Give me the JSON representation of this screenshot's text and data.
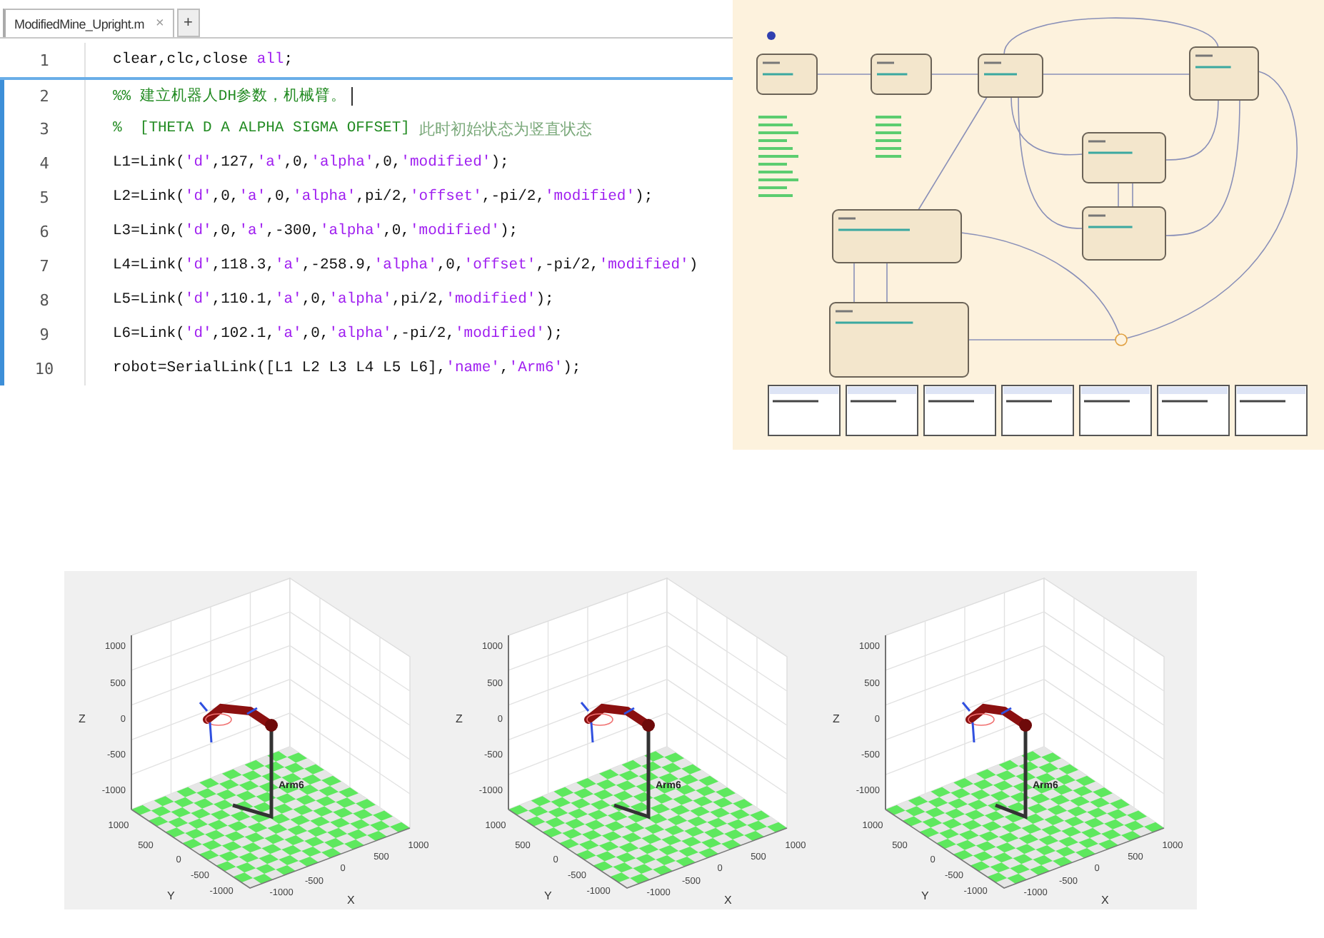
{
  "editor": {
    "tab": {
      "label": "ModifiedMine_Upright.m",
      "close": "×",
      "selected": true
    },
    "new_tab": "+",
    "lines": [
      {
        "number": "1",
        "in_section": false,
        "tokens": [
          {
            "kind": "code",
            "text": "clear,clc,close "
          },
          {
            "kind": "keyword",
            "text": "all"
          },
          {
            "kind": "code",
            "text": ";"
          }
        ]
      },
      {
        "number": "2",
        "in_section": true,
        "cursor": true,
        "tokens": [
          {
            "kind": "comment",
            "text": "%% 建立机器人DH参数，机械臂。"
          }
        ]
      },
      {
        "number": "3",
        "in_section": true,
        "tokens": [
          {
            "kind": "comment",
            "text": "%  [THETA D A ALPHA SIGMA OFFSET] "
          },
          {
            "kind": "comment-cjk",
            "text": "此时初始状态为竖直状态"
          }
        ]
      },
      {
        "number": "4",
        "in_section": true,
        "tokens": [
          {
            "kind": "code",
            "text": "L1=Link("
          },
          {
            "kind": "string",
            "text": "'d'"
          },
          {
            "kind": "code",
            "text": ",127,"
          },
          {
            "kind": "string",
            "text": "'a'"
          },
          {
            "kind": "code",
            "text": ",0,"
          },
          {
            "kind": "string",
            "text": "'alpha'"
          },
          {
            "kind": "code",
            "text": ",0,"
          },
          {
            "kind": "string",
            "text": "'modified'"
          },
          {
            "kind": "code",
            "text": ");"
          }
        ]
      },
      {
        "number": "5",
        "in_section": true,
        "tokens": [
          {
            "kind": "code",
            "text": "L2=Link("
          },
          {
            "kind": "string",
            "text": "'d'"
          },
          {
            "kind": "code",
            "text": ",0,"
          },
          {
            "kind": "string",
            "text": "'a'"
          },
          {
            "kind": "code",
            "text": ",0,"
          },
          {
            "kind": "string",
            "text": "'alpha'"
          },
          {
            "kind": "code",
            "text": ",pi/2,"
          },
          {
            "kind": "string",
            "text": "'offset'"
          },
          {
            "kind": "code",
            "text": ",-pi/2,"
          },
          {
            "kind": "string",
            "text": "'modified'"
          },
          {
            "kind": "code",
            "text": ");"
          }
        ]
      },
      {
        "number": "6",
        "in_section": true,
        "tokens": [
          {
            "kind": "code",
            "text": "L3=Link("
          },
          {
            "kind": "string",
            "text": "'d'"
          },
          {
            "kind": "code",
            "text": ",0,"
          },
          {
            "kind": "string",
            "text": "'a'"
          },
          {
            "kind": "code",
            "text": ",-300,"
          },
          {
            "kind": "string",
            "text": "'alpha'"
          },
          {
            "kind": "code",
            "text": ",0,"
          },
          {
            "kind": "string",
            "text": "'modified'"
          },
          {
            "kind": "code",
            "text": ");"
          }
        ]
      },
      {
        "number": "7",
        "in_section": true,
        "tokens": [
          {
            "kind": "code",
            "text": "L4=Link("
          },
          {
            "kind": "string",
            "text": "'d'"
          },
          {
            "kind": "code",
            "text": ",118.3,"
          },
          {
            "kind": "string",
            "text": "'a'"
          },
          {
            "kind": "code",
            "text": ",-258.9,"
          },
          {
            "kind": "string",
            "text": "'alpha'"
          },
          {
            "kind": "code",
            "text": ",0,"
          },
          {
            "kind": "string",
            "text": "'offset'"
          },
          {
            "kind": "code",
            "text": ",-pi/2,"
          },
          {
            "kind": "string",
            "text": "'modified'"
          },
          {
            "kind": "code",
            "text": ")"
          }
        ]
      },
      {
        "number": "8",
        "in_section": true,
        "tokens": [
          {
            "kind": "code",
            "text": "L5=Link("
          },
          {
            "kind": "string",
            "text": "'d'"
          },
          {
            "kind": "code",
            "text": ",110.1,"
          },
          {
            "kind": "string",
            "text": "'a'"
          },
          {
            "kind": "code",
            "text": ",0,"
          },
          {
            "kind": "string",
            "text": "'alpha'"
          },
          {
            "kind": "code",
            "text": ",pi/2,"
          },
          {
            "kind": "string",
            "text": "'modified'"
          },
          {
            "kind": "code",
            "text": ");"
          }
        ]
      },
      {
        "number": "9",
        "in_section": true,
        "tokens": [
          {
            "kind": "code",
            "text": "L6=Link("
          },
          {
            "kind": "string",
            "text": "'d'"
          },
          {
            "kind": "code",
            "text": ",102.1,"
          },
          {
            "kind": "string",
            "text": "'a'"
          },
          {
            "kind": "code",
            "text": ",0,"
          },
          {
            "kind": "string",
            "text": "'alpha'"
          },
          {
            "kind": "code",
            "text": ",-pi/2,"
          },
          {
            "kind": "string",
            "text": "'modified'"
          },
          {
            "kind": "code",
            "text": ");"
          }
        ]
      },
      {
        "number": "10",
        "in_section": true,
        "tokens": [
          {
            "kind": "code",
            "text": "robot=SerialLink([L1 L2 L3 L4 L5 L6],"
          },
          {
            "kind": "string",
            "text": "'name'"
          },
          {
            "kind": "code",
            "text": ","
          },
          {
            "kind": "string",
            "text": "'Arm6'"
          },
          {
            "kind": "code",
            "text": ");"
          }
        ]
      }
    ]
  },
  "plots": [
    {
      "z_label": "Z",
      "y_label": "Y",
      "x_label": "X",
      "z_ticks": [
        "1000",
        "500",
        "0",
        "-500",
        "-1000"
      ],
      "y_ticks": [
        "1000",
        "500",
        "0",
        "-500",
        "-1000"
      ],
      "x_ticks": [
        "-1000",
        "-500",
        "0",
        "500",
        "1000"
      ],
      "robot_label": "Arm6"
    },
    {
      "z_label": "Z",
      "y_label": "Y",
      "x_label": "X",
      "z_ticks": [
        "1000",
        "500",
        "0",
        "-500",
        "-1000"
      ],
      "y_ticks": [
        "1000",
        "500",
        "0",
        "-500",
        "-1000"
      ],
      "x_ticks": [
        "-1000",
        "-500",
        "0",
        "500",
        "1000"
      ],
      "robot_label": "Arm6"
    },
    {
      "z_label": "Z",
      "y_label": "Y",
      "x_label": "X",
      "z_ticks": [
        "1000",
        "500",
        "0",
        "-500",
        "-1000"
      ],
      "y_ticks": [
        "1000",
        "500",
        "0",
        "-500",
        "-1000"
      ],
      "x_ticks": [
        "-1000",
        "-500",
        "0",
        "500",
        "1000"
      ],
      "robot_label": "Arm6"
    }
  ]
}
